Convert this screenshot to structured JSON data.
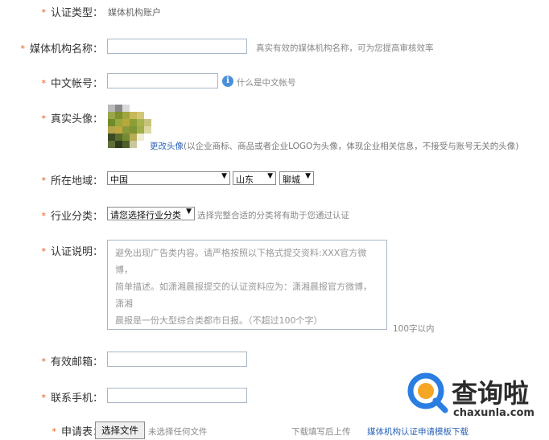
{
  "form": {
    "account_type": {
      "label": "认证类型：",
      "value": "媒体机构账户"
    },
    "org_name": {
      "label": "媒体机构名称：",
      "value": "",
      "hint": "真实有效的媒体机构名称，可为您提高审核效率"
    },
    "chinese_account": {
      "label": "中文帐号：",
      "value": "",
      "hint": "什么是中文帐号",
      "info_icon": "info-icon"
    },
    "avatar": {
      "label": "真实头像：",
      "change_link": "更改头像",
      "hint": "(以企业商标、商品或者企业LOGO为头像，体现企业相关信息，不接受与账号无关的头像)"
    },
    "region": {
      "label": "所在地域：",
      "country": "中国",
      "province": "山东",
      "city": "聊城"
    },
    "industry": {
      "label": "行业分类：",
      "value": "请您选择行业分类",
      "hint": "选择完整合适的分类将有助于您通过认证"
    },
    "description": {
      "label": "认证说明：",
      "placeholder_lines": [
        "避免出现广告类内容。请严格按照以下格式提交资料:XXX官方微博，",
        "简单描述。如潇湘晨报提交的认证资料应为：潇湘晨报官方微博，潇湘",
        "晨报是一份大型综合类都市日报。（不超过100个字）"
      ],
      "counter": "100字以内"
    },
    "email": {
      "label": "有效邮箱：",
      "value": ""
    },
    "phone": {
      "label": "联系手机：",
      "value": ""
    },
    "application": {
      "label": "申请表：",
      "file_button": "选择文件",
      "file_status": "未选择任何文件",
      "hint": "下载填写后上传",
      "template_link": "媒体机构认证申请模板下载"
    }
  },
  "watermark": {
    "logo_text": "查询啦",
    "domain": "chaxunla.com",
    "brand_color": "#2a7de1"
  },
  "required_mark": "*"
}
